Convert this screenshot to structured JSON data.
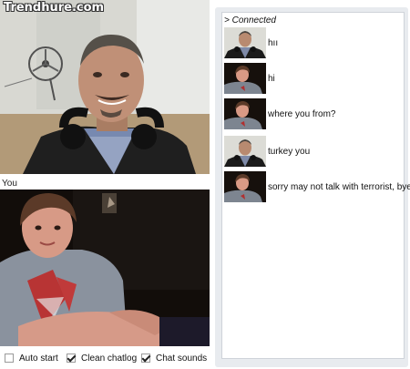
{
  "watermark": "Trendhure.com",
  "you_label": "You",
  "chat": {
    "status": "> Connected",
    "messages": [
      {
        "sender": "stranger",
        "text": "hıı"
      },
      {
        "sender": "you",
        "text": "hi"
      },
      {
        "sender": "you",
        "text": "where you from?"
      },
      {
        "sender": "stranger",
        "text": "turkey you"
      },
      {
        "sender": "you",
        "text": "sorry may not talk with terrorist, bye"
      }
    ]
  },
  "options": [
    {
      "label": "Auto start",
      "checked": false
    },
    {
      "label": "Clean chatlog",
      "checked": true
    },
    {
      "label": "Chat sounds",
      "checked": true
    }
  ],
  "colors": {
    "chat_frame": "#e8ebef",
    "page": "#ffffff",
    "chat_log": "#ffffff"
  }
}
